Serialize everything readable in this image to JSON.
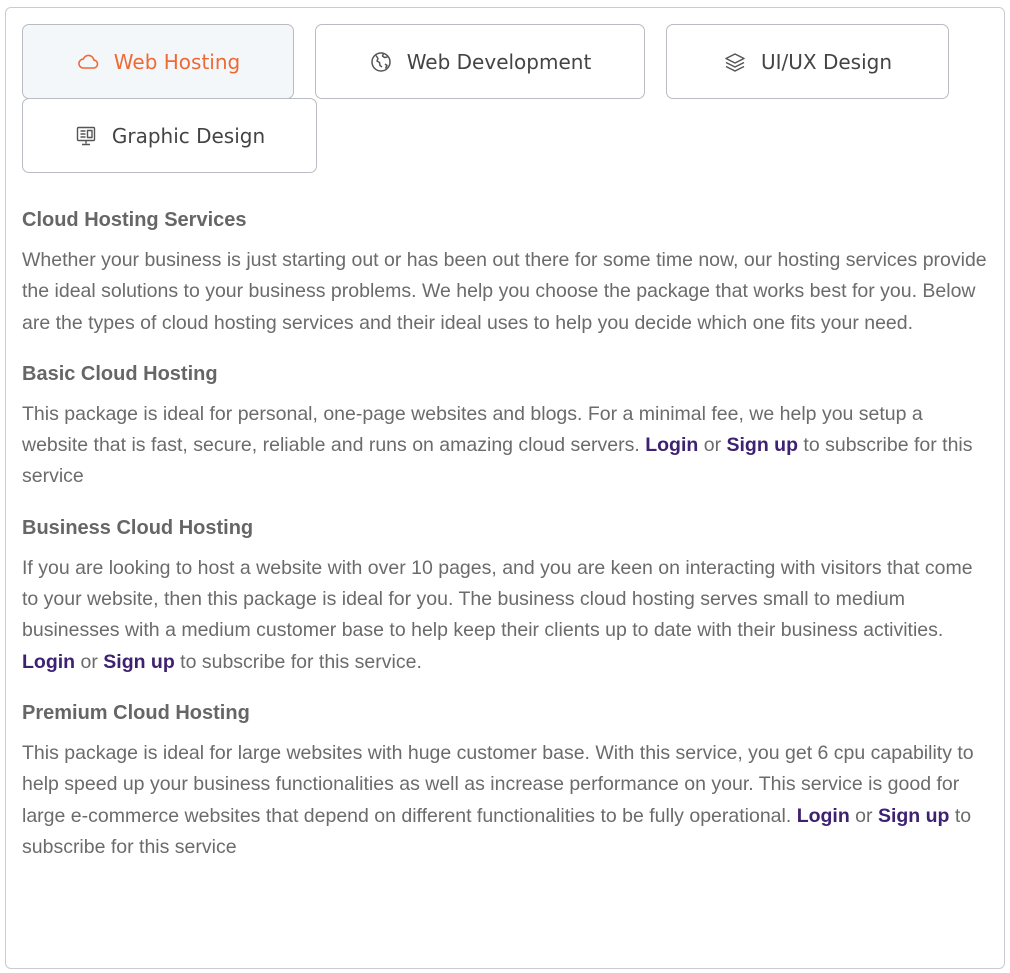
{
  "tabs": [
    {
      "label": "Web Hosting",
      "icon": "cloud-icon",
      "active": true
    },
    {
      "label": "Web Development",
      "icon": "globe-icon",
      "active": false
    },
    {
      "label": "UI/UX Design",
      "icon": "layers-icon",
      "active": false
    },
    {
      "label": "Graphic Design",
      "icon": "design-board-icon",
      "active": false
    }
  ],
  "colors": {
    "active_tab_text": "#ee6a34",
    "link": "#3e2170",
    "body_text": "#6b6b6b"
  },
  "content": {
    "intro": {
      "title": "Cloud Hosting Services",
      "text": "Whether your business is just starting out or has been out there for some time now, our hosting services provide the ideal solutions to your business problems. We help you choose the package that works best for you. Below are the types of cloud hosting  services and their ideal uses to help you decide which one fits your need."
    },
    "basic": {
      "title": "Basic Cloud Hosting",
      "text_before": "This package is ideal for personal, one-page websites and blogs. For a minimal fee, we help you setup a website that is fast, secure, reliable and runs on amazing cloud servers. ",
      "login": "Login",
      "or": " or ",
      "signup": "Sign up",
      "text_after": " to subscribe for this service"
    },
    "business": {
      "title": "Business Cloud Hosting",
      "text_before": "If you are looking to host a website with over 10 pages, and you are keen on interacting with visitors that come to your website, then this package is ideal for you. The business cloud hosting serves small to medium businesses with a medium customer base to help keep their clients up to date with their business activities.   ",
      "login": "Login",
      "or": " or ",
      "signup": "Sign up",
      "text_after": " to subscribe for this service."
    },
    "premium": {
      "title": "Premium Cloud Hosting",
      "text_before": "This package is ideal for large websites with huge customer base. With this service, you get 6 cpu capability to help speed up your business functionalities as well as increase performance on your. This service is good for large e-commerce websites that depend on different functionalities to be fully operational. ",
      "login": "Login",
      "or": " or ",
      "signup": "Sign up",
      "text_after": " to subscribe for this service"
    }
  }
}
